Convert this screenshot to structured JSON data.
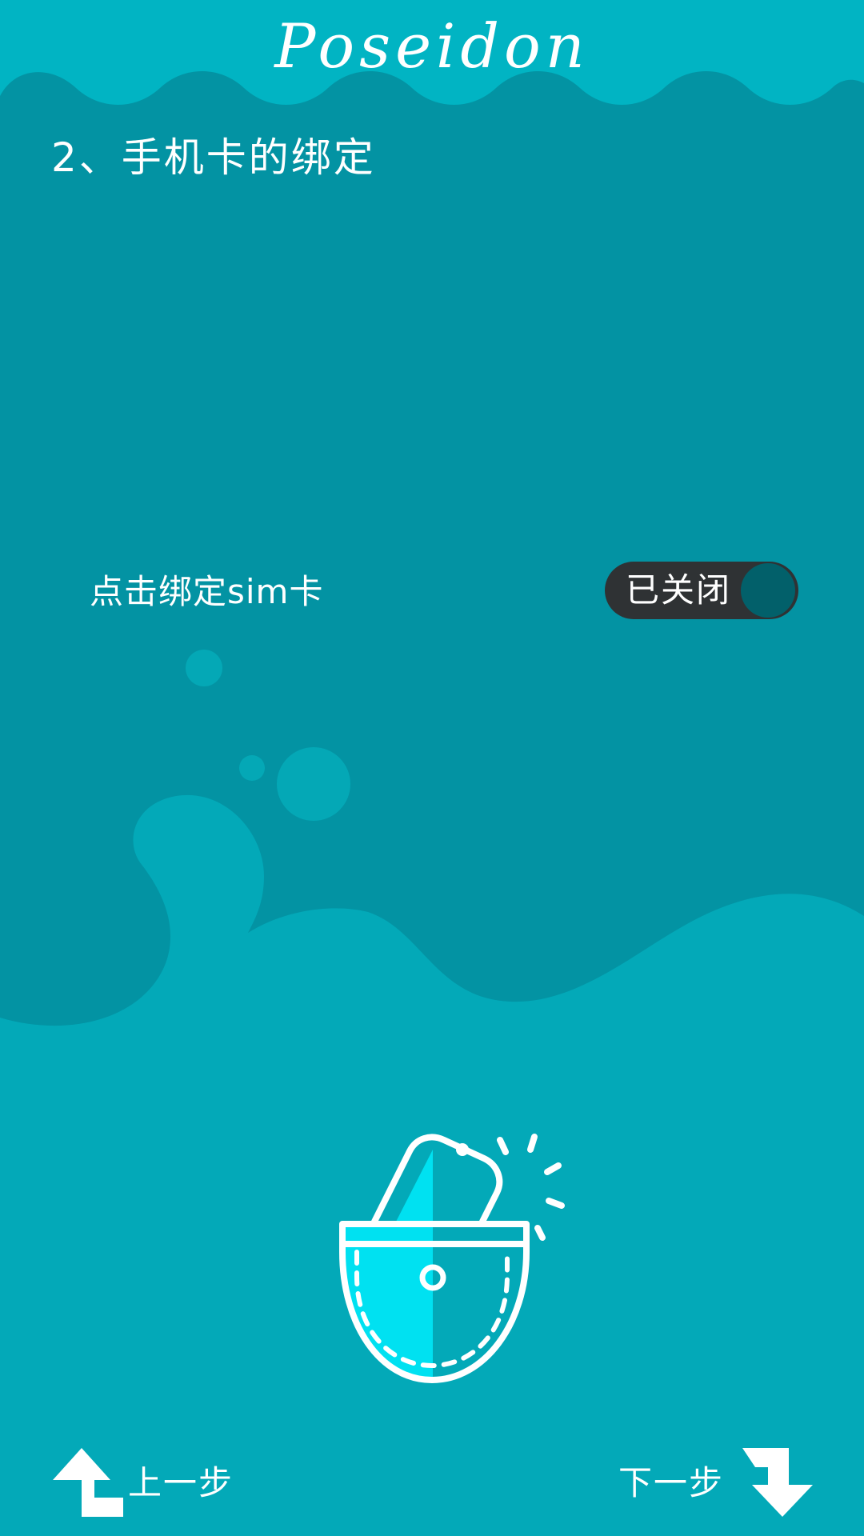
{
  "header": {
    "logo_text": "Poseidon"
  },
  "page": {
    "title": "2、手机卡的绑定"
  },
  "sim_binding": {
    "label": "点击绑定sim卡",
    "toggle_text": "已关闭",
    "enabled": false
  },
  "navigation": {
    "prev_label": "上一步",
    "next_label": "下一步"
  },
  "icons": {
    "illustration": "pocket-phone-icon",
    "prev": "arrow-up-left-icon",
    "next": "arrow-down-right-icon"
  },
  "colors": {
    "header_bg": "#01b4c3",
    "main_bg": "#0393a3",
    "wave_bg": "#03a9b8",
    "accent": "#00e1f1",
    "toggle_bg": "#2f3234",
    "toggle_knob": "#02606a",
    "text": "#ffffff"
  }
}
